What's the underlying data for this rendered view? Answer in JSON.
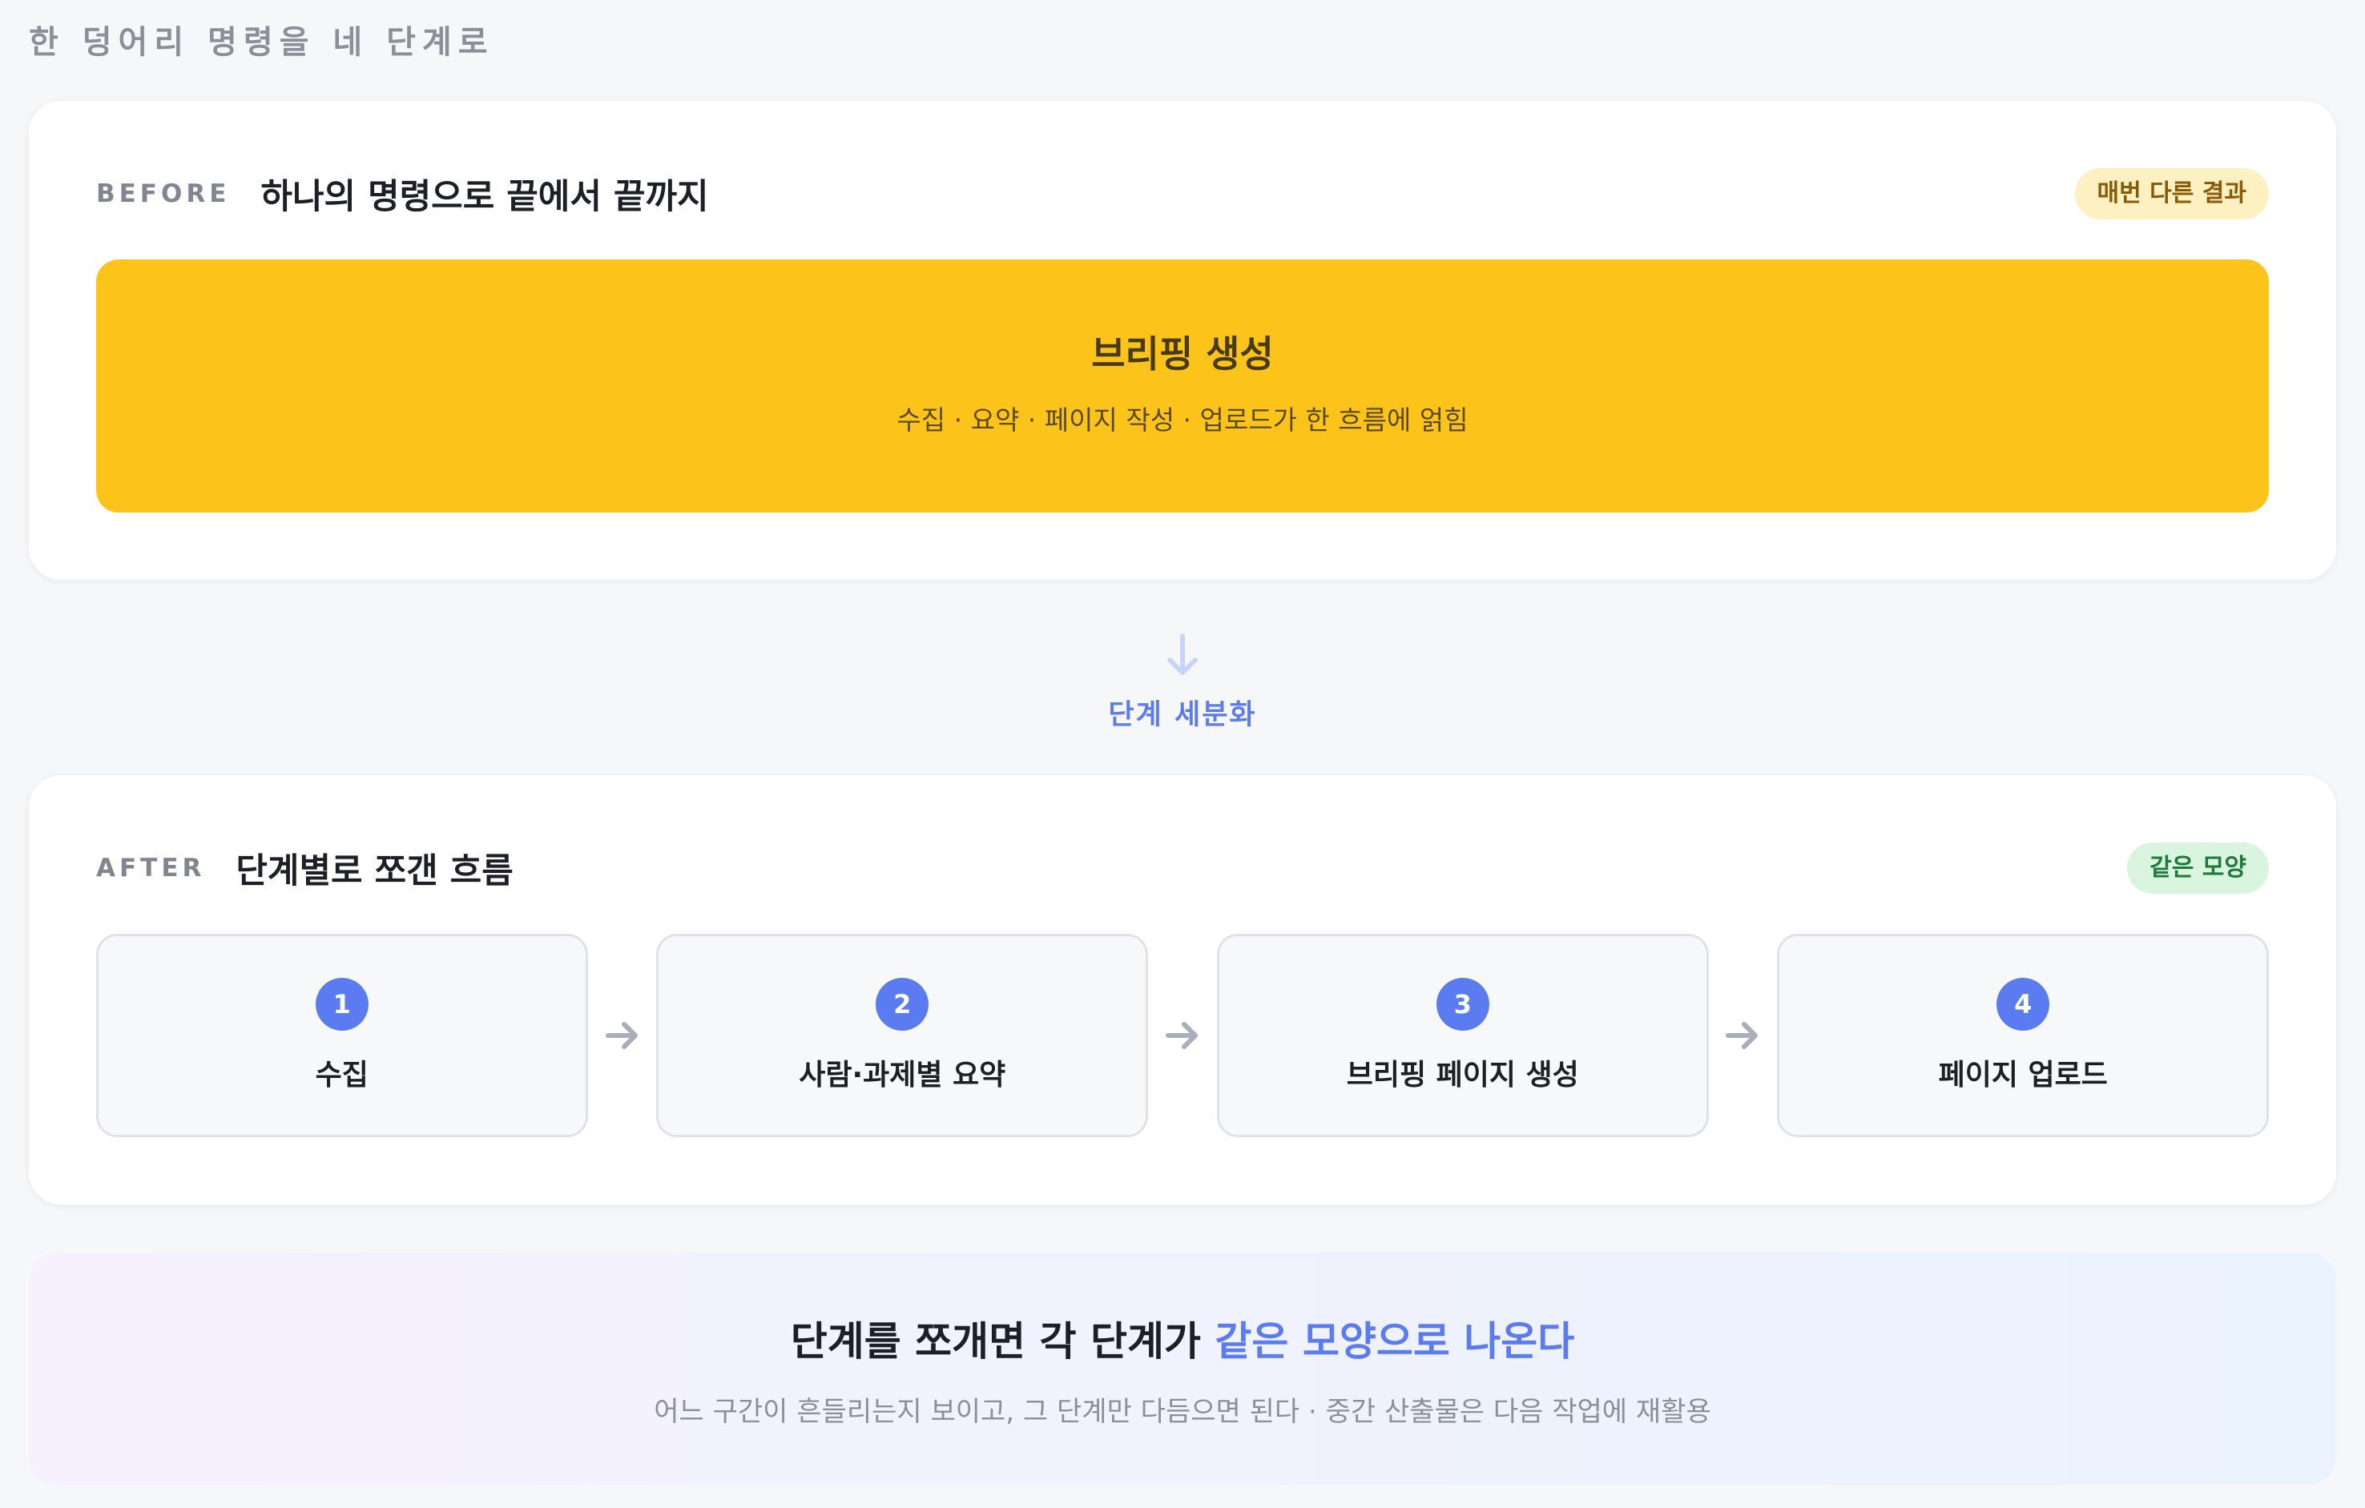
{
  "page": {
    "title": "한 덩어리 명령을 네 단계로"
  },
  "before": {
    "tag": "BEFORE",
    "title": "하나의 명령으로 끝에서 끝까지",
    "badge": "매번 다른 결과",
    "block": {
      "title": "브리핑 생성",
      "subtitle": "수집 · 요약 · 페이지 작성 · 업로드가 한 흐름에 얽힘"
    }
  },
  "transition": {
    "label": "단계 세분화",
    "icon": "arrow-down-icon"
  },
  "after": {
    "tag": "AFTER",
    "title": "단계별로 쪼갠 흐름",
    "badge": "같은 모양",
    "steps": [
      {
        "number": "1",
        "label": "수집"
      },
      {
        "number": "2",
        "label": "사람·과제별 요약"
      },
      {
        "number": "3",
        "label": "브리핑 페이지 생성"
      },
      {
        "number": "4",
        "label": "페이지 업로드"
      }
    ]
  },
  "summary": {
    "title_prefix": "단계를 쪼개면 각 단계가 ",
    "title_accent": "같은 모양으로 나온다",
    "subtitle": "어느 구간이 흔들리는지 보이고, 그 단계만 다듬으면 된다 · 중간 산출물은 다음 작업에 재활용"
  },
  "colors": {
    "accent": "#5b7cf0",
    "before_block": "#fcc41a",
    "badge_yellow_bg": "#fdf1c2",
    "badge_green_bg": "#d9f5df"
  }
}
